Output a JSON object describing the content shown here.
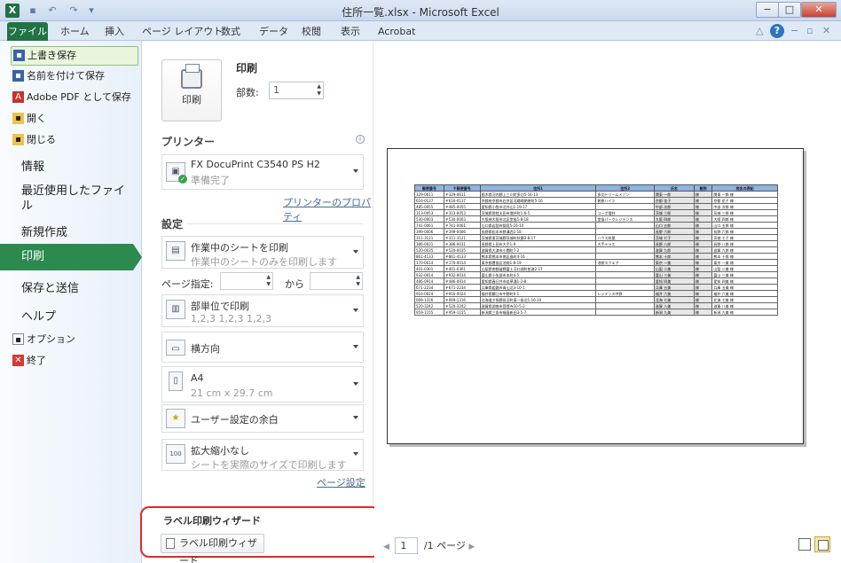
{
  "window": {
    "title": "住所一覧.xlsx - Microsoft Excel",
    "app_icon": "X",
    "min_label": "−",
    "max_label": "□",
    "close_label": "✕"
  },
  "ribbon": {
    "tabs": [
      "ファイル",
      "ホーム",
      "挿入",
      "ページ レイアウト",
      "数式",
      "データ",
      "校閲",
      "表示",
      "Acrobat"
    ],
    "help_label": "?"
  },
  "backstage_nav": {
    "small_items": [
      {
        "label": "上書き保存",
        "icon": "save-icon"
      },
      {
        "label": "名前を付けて保存",
        "icon": "save-as-icon"
      },
      {
        "label": "Adobe PDF として保存",
        "icon": "pdf-icon"
      },
      {
        "label": "開く",
        "icon": "open-folder-icon"
      },
      {
        "label": "閉じる",
        "icon": "close-file-icon"
      }
    ],
    "big_items": [
      "情報",
      "最近使用したファイル",
      "新規作成",
      "印刷",
      "保存と送信",
      "ヘルプ"
    ],
    "bottom_items": [
      {
        "label": "オプション",
        "icon": "options-icon"
      },
      {
        "label": "終了",
        "icon": "exit-icon"
      }
    ]
  },
  "print_panel": {
    "heading": "印刷",
    "print_button": "印刷",
    "copies_label": "部数:",
    "copies_value": "1",
    "printer_section": "プリンター",
    "printer_name": "FX DocuPrint C3540 PS H2",
    "printer_status": "準備完了",
    "printer_properties_link": "プリンターのプロパティ",
    "settings_section": "設定",
    "print_what": {
      "line1": "作業中のシートを印刷",
      "line2": "作業中のシートのみを印刷します"
    },
    "pages_label": "ページ指定:",
    "pages_to": "から",
    "collation": {
      "line1": "部単位で印刷",
      "line2": "1,2,3   1,2,3   1,2,3"
    },
    "orientation": "横方向",
    "paper": {
      "line1": "A4",
      "line2": "21 cm x 29.7 cm"
    },
    "margins": "ユーザー設定の余白",
    "scaling": {
      "line1": "拡大縮小なし",
      "line2": "シートを実際のサイズで印刷します"
    },
    "page_setup_link": "ページ設定"
  },
  "label_wizard": {
    "title": "ラベル印刷ウィザード",
    "button": "ラベル印刷ウィザード"
  },
  "preview": {
    "page_current": "1",
    "page_total": "/1 ページ",
    "table_headers": [
      "郵便番号",
      "〒郵便番号",
      "住所1",
      "住所2",
      "氏名",
      "敬称",
      "宛名の表記"
    ],
    "table_rows": [
      [
        "329-0611",
        "〒329-0611",
        "栃木県河内郡上三川町多功5-16-13",
        "多功ドリームメゾン",
        "関東 一郎",
        "様",
        "関東 一郎 様"
      ],
      [
        "616-0137",
        "〒616-0137",
        "京都府京都市右京区北嵯峨朝原町5-16",
        "朝原ハイツ",
        "京都 花子",
        "様",
        "京都 花子 様"
      ],
      [
        "485-0055",
        "〒485-0055",
        "愛知県小牧市北外山1-19-17",
        "",
        "中部 次郎",
        "様",
        "中部 次郎 様"
      ],
      [
        "313-0053",
        "〒313-0053",
        "茨城県常陸太田市増井町1-6-5",
        "コーポ増井",
        "茨城 三郎",
        "様",
        "茨城 三郎 様"
      ],
      [
        "530-0003",
        "〒530-0003",
        "大阪府大阪市北区堂島5-8-18",
        "堂島パークレジデンス",
        "大阪 四郎",
        "様",
        "大阪 四郎 様"
      ],
      [
        "741-0061",
        "〒741-0061",
        "山口県岩国市錦見5-16-10",
        "",
        "山口 五郎",
        "様",
        "山口 五郎 様"
      ],
      [
        "399-0006",
        "〒399-0006",
        "長野県松本市野溝西1-18",
        "",
        "長野 六郎",
        "様",
        "長野 六郎 様"
      ],
      [
        "311-3121",
        "〒311-3121",
        "茨城県東茨城郡茨城町秋葉3-8-17",
        "ハウス秋葉",
        "茨城 七子",
        "様",
        "茨城 七子 様"
      ],
      [
        "386-0031",
        "〒386-0031",
        "長野県上田市大手1-9",
        "大手テラス",
        "長野 八郎",
        "様",
        "長野 八郎 様"
      ],
      [
        "520-0035",
        "〒520-0035",
        "滋賀県大津市小関町7-2",
        "",
        "滋賀 九郎",
        "様",
        "滋賀 九郎 様"
      ],
      [
        "861-4133",
        "〒861-4133",
        "熊本県熊本市南区島町4-16",
        "",
        "熊本 十郎",
        "様",
        "熊本 十郎 様"
      ],
      [
        "170-0014",
        "〒170-0014",
        "東京都豊島区池袋1-8-19",
        "池袋スクエア",
        "東京 一美",
        "様",
        "東京 一美 様"
      ],
      [
        "401-0301",
        "〒401-0301",
        "山梨県南都留郡富士河口湖町船津2-17",
        "",
        "山梨 二美",
        "様",
        "山梨 二美 様"
      ],
      [
        "932-0014",
        "〒932-0014",
        "富山県小矢部市本町4-5",
        "",
        "富山 三美",
        "様",
        "富山 三美 様"
      ],
      [
        "486-0914",
        "〒486-0914",
        "愛知県春日井市若草通1-2-8",
        "",
        "愛知 四美",
        "様",
        "愛知 四美 様"
      ],
      [
        "671-2234",
        "〒671-2234",
        "兵庫県姫路市青山北3-10-1",
        "",
        "兵庫 五美",
        "様",
        "兵庫 五美 様"
      ],
      [
        "916-0024",
        "〒916-0024",
        "福井県鯖江市中野町6-1",
        "レジデンス中野",
        "福井 六美",
        "様",
        "福井 六美 様"
      ],
      [
        "069-1316",
        "〒069-1316",
        "北海道夕張郡長沼町東一条北1-16-10",
        "",
        "北海 七美",
        "様",
        "北海 七美 様"
      ],
      [
        "520-3242",
        "〒520-3242",
        "滋賀県湖南市菩提寺10-5-2",
        "",
        "滋賀 八美",
        "様",
        "滋賀 八美 様"
      ],
      [
        "959-1155",
        "〒959-1155",
        "新潟県三条市福島新田3-5-7",
        "",
        "新潟 九美",
        "様",
        "新潟 九美 様"
      ]
    ]
  }
}
